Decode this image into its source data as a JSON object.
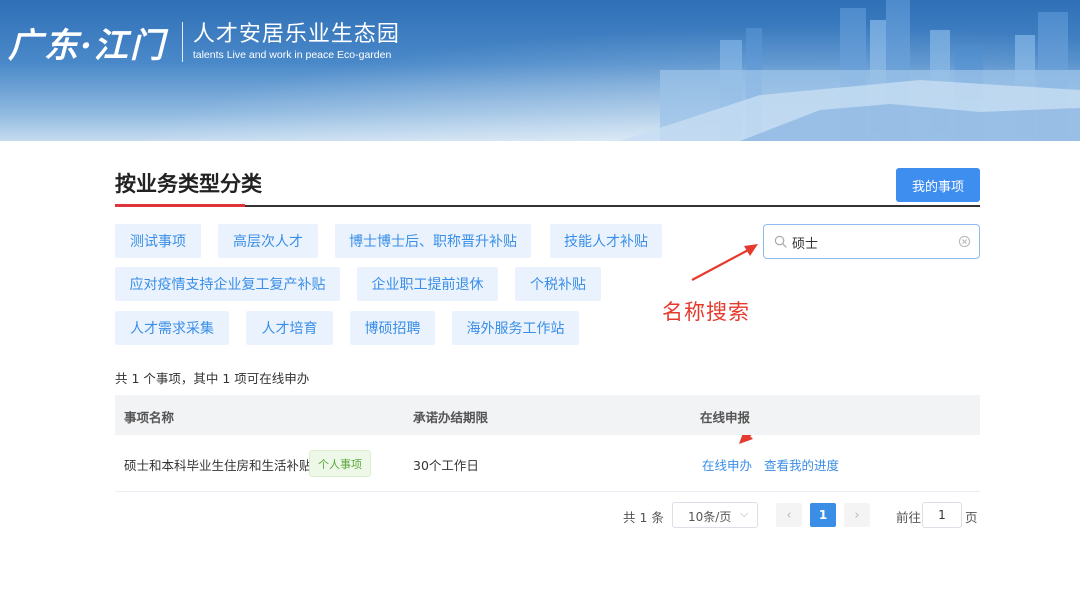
{
  "banner": {
    "brand_cn": "广东·江门",
    "title": "人才安居乐业生态园",
    "subtitle": "talents Live and work in peace Eco-garden"
  },
  "section": {
    "title": "按业务类型分类",
    "my_items_button": "我的事项"
  },
  "categories": [
    "测试事项",
    "高层次人才",
    "博士博士后、职称晋升补贴",
    "技能人才补贴",
    "应对疫情支持企业复工复产补贴",
    "企业职工提前退休",
    "个税补贴",
    "人才需求采集",
    "人才培育",
    "博硕招聘",
    "海外服务工作站"
  ],
  "search": {
    "value": "硕士",
    "icon": "search-icon",
    "clear_icon": "clear-icon"
  },
  "annotation": {
    "label": "名称搜索",
    "color": "#e53a2e"
  },
  "summary": "共 1 个事项，其中 1 项可在线申办",
  "table": {
    "columns": [
      "事项名称",
      "承诺办结期限",
      "在线申报"
    ],
    "rows": [
      {
        "name": "硕士和本科毕业生住房和生活补贴",
        "badge": "个人事项",
        "deadline": "30个工作日",
        "actions": [
          "在线申办",
          "查看我的进度"
        ]
      }
    ]
  },
  "pagination": {
    "total": "共 1 条",
    "page_size": "10条/页",
    "prev": "‹",
    "next": "›",
    "current_page": "1",
    "goto_label": "前往",
    "goto_value": "1",
    "page_unit": "页"
  },
  "colors": {
    "accent": "#3a8ee6",
    "primary_button": "#3e8ef0",
    "title_underline": "#e0333b"
  }
}
